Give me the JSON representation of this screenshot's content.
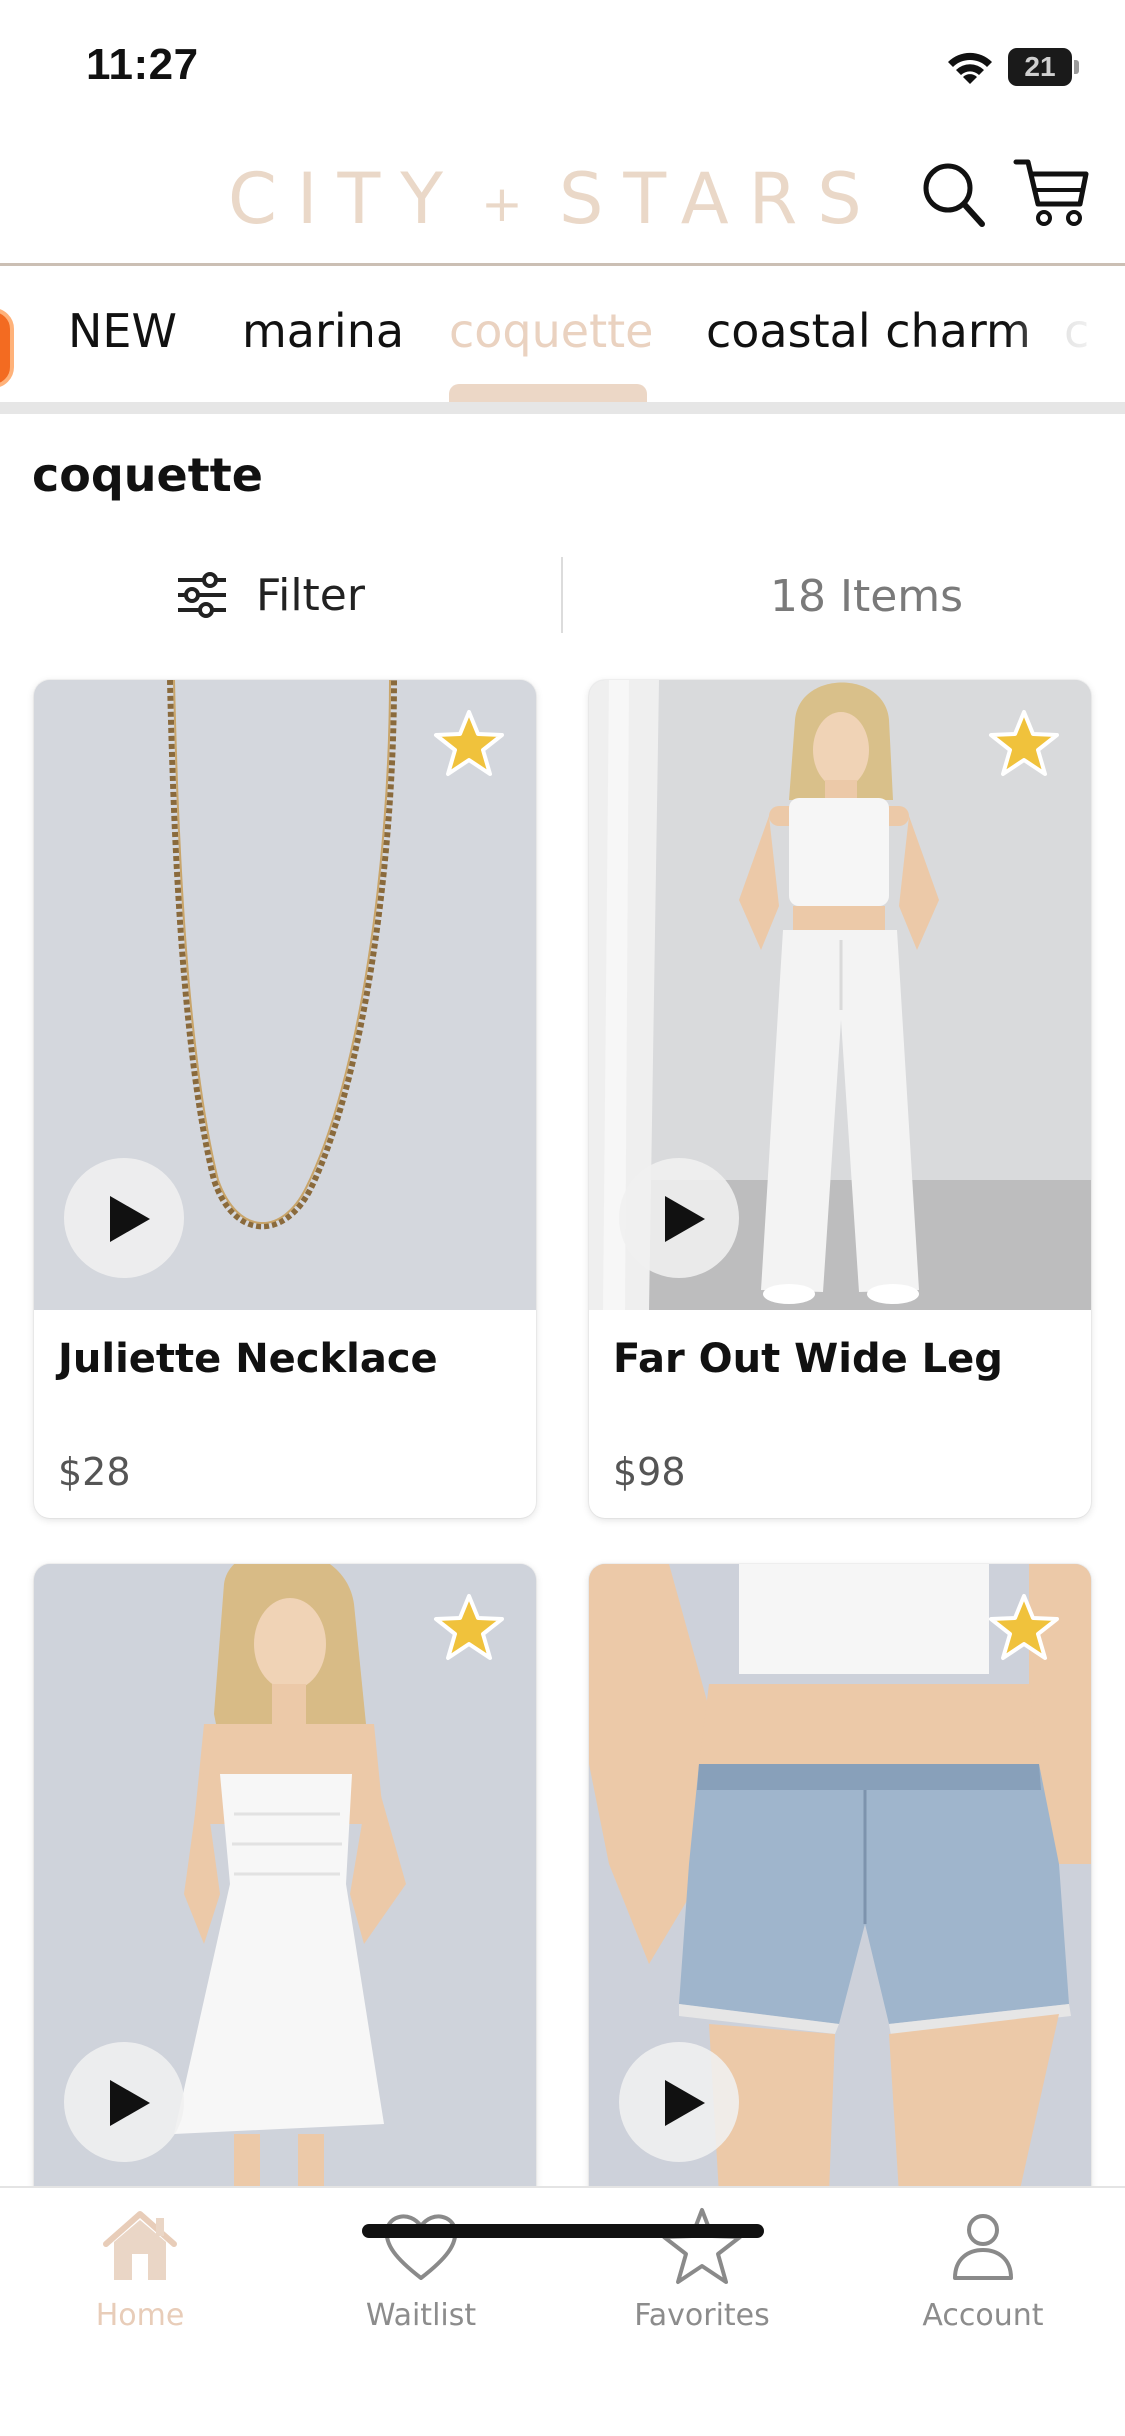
{
  "status_bar": {
    "time": "11:27",
    "battery": "21"
  },
  "header": {
    "brand_left": "CITY",
    "brand_plus": "+",
    "brand_right": "STARS",
    "brand_color": "#ead8c8"
  },
  "tabs": [
    {
      "label": "NEW",
      "active": false
    },
    {
      "label": "marina",
      "active": false
    },
    {
      "label": "coquette",
      "active": true
    },
    {
      "label": "coastal charm",
      "active": false
    },
    {
      "label": "c",
      "active": false
    }
  ],
  "section": {
    "title": "coquette"
  },
  "filter": {
    "label": "Filter",
    "count": "18 Items"
  },
  "products": [
    {
      "name": "Juliette Necklace",
      "price": "$28",
      "favorite_icon": "star-icon",
      "has_video": true
    },
    {
      "name": "Far Out Wide Leg",
      "price": "$98",
      "favorite_icon": "star-icon",
      "has_video": true
    },
    {
      "name": "",
      "price": "",
      "favorite_icon": "star-icon",
      "has_video": true
    },
    {
      "name": "",
      "price": "",
      "favorite_icon": "star-icon",
      "has_video": true
    }
  ],
  "bottom_nav": [
    {
      "label": "Home",
      "icon": "home-icon",
      "active": true
    },
    {
      "label": "Waitlist",
      "icon": "heart-icon",
      "active": false
    },
    {
      "label": "Favorites",
      "icon": "star-icon",
      "active": false
    },
    {
      "label": "Account",
      "icon": "person-icon",
      "active": false
    }
  ],
  "colors": {
    "accent": "#ead2c0",
    "star": "#f0c23c",
    "tab_active_indicator": "#ecd7c6",
    "badge": "#f36b21"
  }
}
